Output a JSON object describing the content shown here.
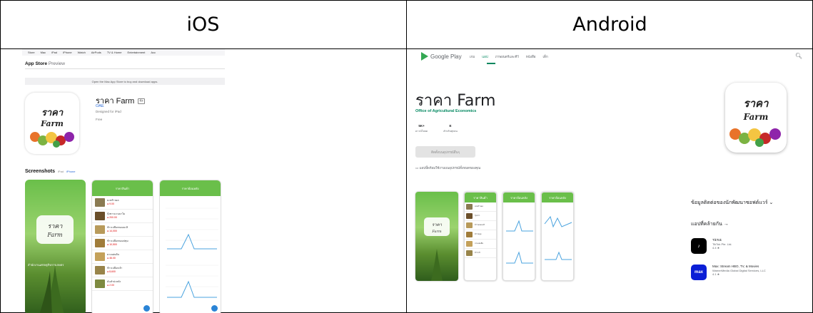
{
  "headers": {
    "ios": "iOS",
    "android": "Android"
  },
  "ios": {
    "nav": [
      "Store",
      "Mac",
      "iPad",
      "iPhone",
      "Watch",
      "AirPods",
      "TV & Home",
      "Entertainment",
      "Acc"
    ],
    "store_title": "App Store",
    "store_sub": "Preview",
    "banner": "Open the Mac App Store to buy and download apps.",
    "app_name": "ราคา Farm",
    "age": "4+",
    "developer": "OAE",
    "designed_for": "Designed for iPad",
    "price": "Free",
    "screenshots_title": "Screenshots",
    "screenshot_tabs": [
      "iPad",
      "iPhone"
    ],
    "shot1_caption": "สำนักงานเศรษฐกิจการเกษตร",
    "shot2_title": "ราคาสินค้า",
    "shot3_title": "ราคาย้อนหลัง"
  },
  "android": {
    "store_name": "Google Play",
    "tabs": [
      "เกม",
      "แอป",
      "ภาพยนตร์และทีวี",
      "หนังสือ",
      "เด็ก"
    ],
    "app_name": "ราคา Farm",
    "developer": "Office of Agricultural Economics",
    "downloads_value": "5K+",
    "downloads_label": "ดาวน์โหลด",
    "rating_value": "E",
    "rating_label": "สำหรับทุกคน",
    "install_label": "ติดตั้งบนอุปกรณ์อื่นๆ",
    "note": "แอปนี้พร้อมใช้งานบนอุปกรณ์ทั้งหมดของคุณ",
    "contact_title": "ข้อมูลติดต่อของนักพัฒนาซอฟต์แวร์",
    "similar_title": "แอปที่คล้ายกัน",
    "similar": [
      {
        "name": "TikTok",
        "dev": "TikTok Pte. Ltd.",
        "rating": "4.4 ★",
        "color": "#000000",
        "glyph": "♪"
      },
      {
        "name": "Max: Stream HBO, TV, & Movies",
        "dev": "WarnerMedia Global Digital Services, LLC",
        "rating": "4.1 ★",
        "color": "#0b1fd6",
        "glyph": "max"
      }
    ]
  },
  "colors": {
    "accent_green": "#01875f",
    "app_green": "#6abf4a",
    "ios_blue": "#2a6ad6"
  }
}
